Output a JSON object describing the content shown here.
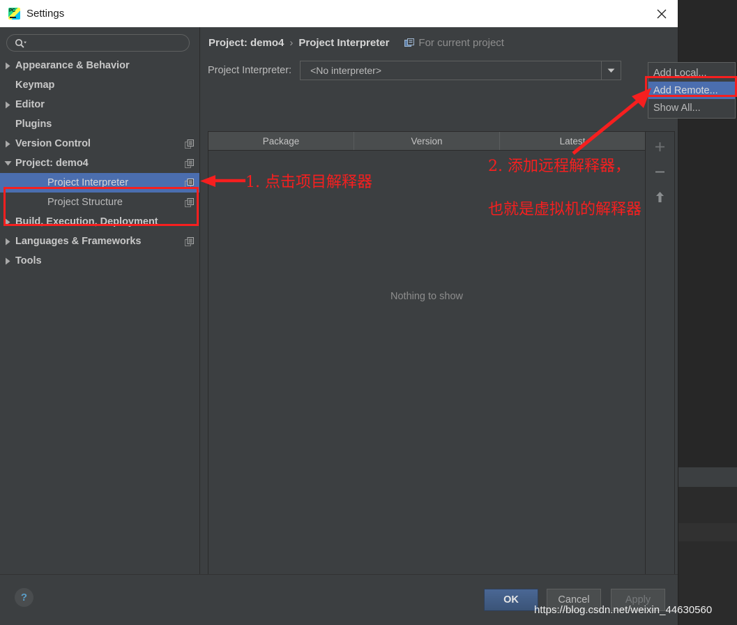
{
  "window": {
    "title": "Settings",
    "app_icon": "pycharm-icon",
    "close_icon": "close-icon"
  },
  "sidebar": {
    "search": {
      "placeholder": "",
      "value": "",
      "icon": "search-icon"
    },
    "items": [
      {
        "label": "Appearance & Behavior",
        "level": 1,
        "arrow": "collapsed",
        "badge": false,
        "selected": false
      },
      {
        "label": "Keymap",
        "level": 1,
        "arrow": "none",
        "badge": false,
        "selected": false
      },
      {
        "label": "Editor",
        "level": 1,
        "arrow": "collapsed",
        "badge": false,
        "selected": false
      },
      {
        "label": "Plugins",
        "level": 1,
        "arrow": "none",
        "badge": false,
        "selected": false
      },
      {
        "label": "Version Control",
        "level": 1,
        "arrow": "collapsed",
        "badge": true,
        "selected": false
      },
      {
        "label": "Project: demo4",
        "level": 1,
        "arrow": "expanded",
        "badge": true,
        "selected": false
      },
      {
        "label": "Project Interpreter",
        "level": 2,
        "arrow": "none",
        "badge": true,
        "selected": true
      },
      {
        "label": "Project Structure",
        "level": 2,
        "arrow": "none",
        "badge": true,
        "selected": false
      },
      {
        "label": "Build, Execution, Deployment",
        "level": 1,
        "arrow": "collapsed",
        "badge": false,
        "selected": false
      },
      {
        "label": "Languages & Frameworks",
        "level": 1,
        "arrow": "collapsed",
        "badge": true,
        "selected": false
      },
      {
        "label": "Tools",
        "level": 1,
        "arrow": "collapsed",
        "badge": false,
        "selected": false
      }
    ]
  },
  "main": {
    "breadcrumb": {
      "project": "Project: demo4",
      "separator": "›",
      "page": "Project Interpreter",
      "scope_label": "For current project",
      "scope_icon": "scope-icon"
    },
    "interpreter": {
      "label": "Project Interpreter:",
      "value": "<No interpreter>",
      "dropdown_icon": "chevron-down-icon"
    },
    "table": {
      "columns": [
        "Package",
        "Version",
        "Latest"
      ],
      "rows": [],
      "empty_message": "Nothing to show"
    },
    "toolbar": [
      {
        "name": "add-package-button",
        "icon": "plus-icon",
        "label": "+"
      },
      {
        "name": "remove-package-button",
        "icon": "minus-icon",
        "label": "−"
      },
      {
        "name": "upgrade-package-button",
        "icon": "arrow-up-icon",
        "label": "↑"
      }
    ]
  },
  "menu": {
    "items": [
      {
        "label": "Add Local...",
        "highlighted": false
      },
      {
        "label": "Add Remote...",
        "highlighted": true
      },
      {
        "label": "Show All...",
        "highlighted": false
      }
    ]
  },
  "footer": {
    "help_label": "?",
    "ok_label": "OK",
    "cancel_label": "Cancel",
    "apply_label": "Apply"
  },
  "annotations": {
    "step1": "1. 点击项目解释器",
    "step2_line1": "2. 添加远程解释器，",
    "step2_line2": "也就是虚拟机的解释器",
    "color": "#f61f1f"
  },
  "watermark": "https://blog.csdn.net/weixin_44630560",
  "colors": {
    "selection_blue": "#4b6eaf",
    "annotation_red": "#f61f1f",
    "panel_bg": "#3c3f41",
    "ok_button": "#4a6794"
  }
}
